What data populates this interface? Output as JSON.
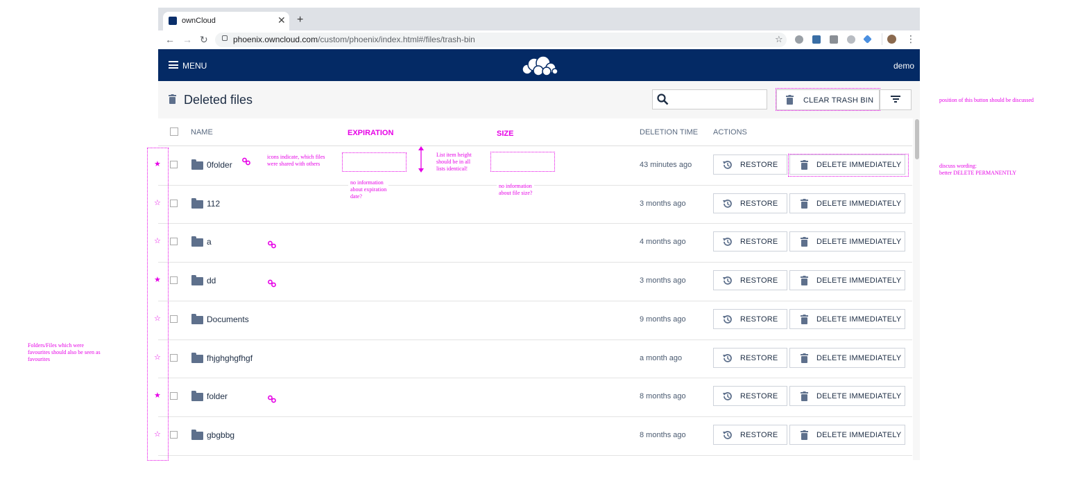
{
  "browser": {
    "tab_title": "ownCloud",
    "url_domain": "phoenix.owncloud.com",
    "url_path": "/custom/phoenix/index.html#/files/trash-bin"
  },
  "app": {
    "menu_label": "MENU",
    "user": "demo",
    "brand_color": "#042a65"
  },
  "page": {
    "title": "Deleted files",
    "search_placeholder": "",
    "clear_label": "CLEAR TRASH BIN"
  },
  "table": {
    "headers": {
      "name": "NAME",
      "expiration": "EXPIRATION",
      "size": "SIZE",
      "deletion_time": "DELETION TIME",
      "actions": "ACTIONS"
    },
    "restore_label": "RESTORE",
    "delete_label": "DELETE IMMEDIATELY",
    "rows": [
      {
        "name": "0folder",
        "time": "43 minutes ago",
        "favorite": true,
        "shared": true
      },
      {
        "name": "112",
        "time": "3 months ago",
        "favorite": false,
        "shared": false
      },
      {
        "name": "a",
        "time": "4 months ago",
        "favorite": false,
        "shared": true
      },
      {
        "name": "dd",
        "time": "3 months ago",
        "favorite": true,
        "shared": true
      },
      {
        "name": "Documents",
        "time": "9 months ago",
        "favorite": false,
        "shared": false
      },
      {
        "name": "fhjghghgfhgf",
        "time": "a month ago",
        "favorite": false,
        "shared": false
      },
      {
        "name": "folder",
        "time": "8 months ago",
        "favorite": true,
        "shared": true
      },
      {
        "name": "gbgbbg",
        "time": "8 months ago",
        "favorite": false,
        "shared": false
      }
    ]
  },
  "annotations": {
    "button_position": "position of this button should be discussed",
    "wording_line1": "discuss wording:",
    "wording_line2": "better DELETE PERMANENTLY",
    "icons_line1": "icons indicate, which files",
    "icons_line2": "were shared with others",
    "height_line1": "List item height",
    "height_line2": "should be in all",
    "height_line3": "lists identical!",
    "exp_line1": "no information",
    "exp_line2": "about expiration",
    "exp_line3": "date?",
    "size_line1": "no information",
    "size_line2": "about file size?",
    "fav_line1": "Folders/Files which were",
    "fav_line2": "favourites should also be seen as",
    "fav_line3": "favourites",
    "color": "#e600e6"
  }
}
